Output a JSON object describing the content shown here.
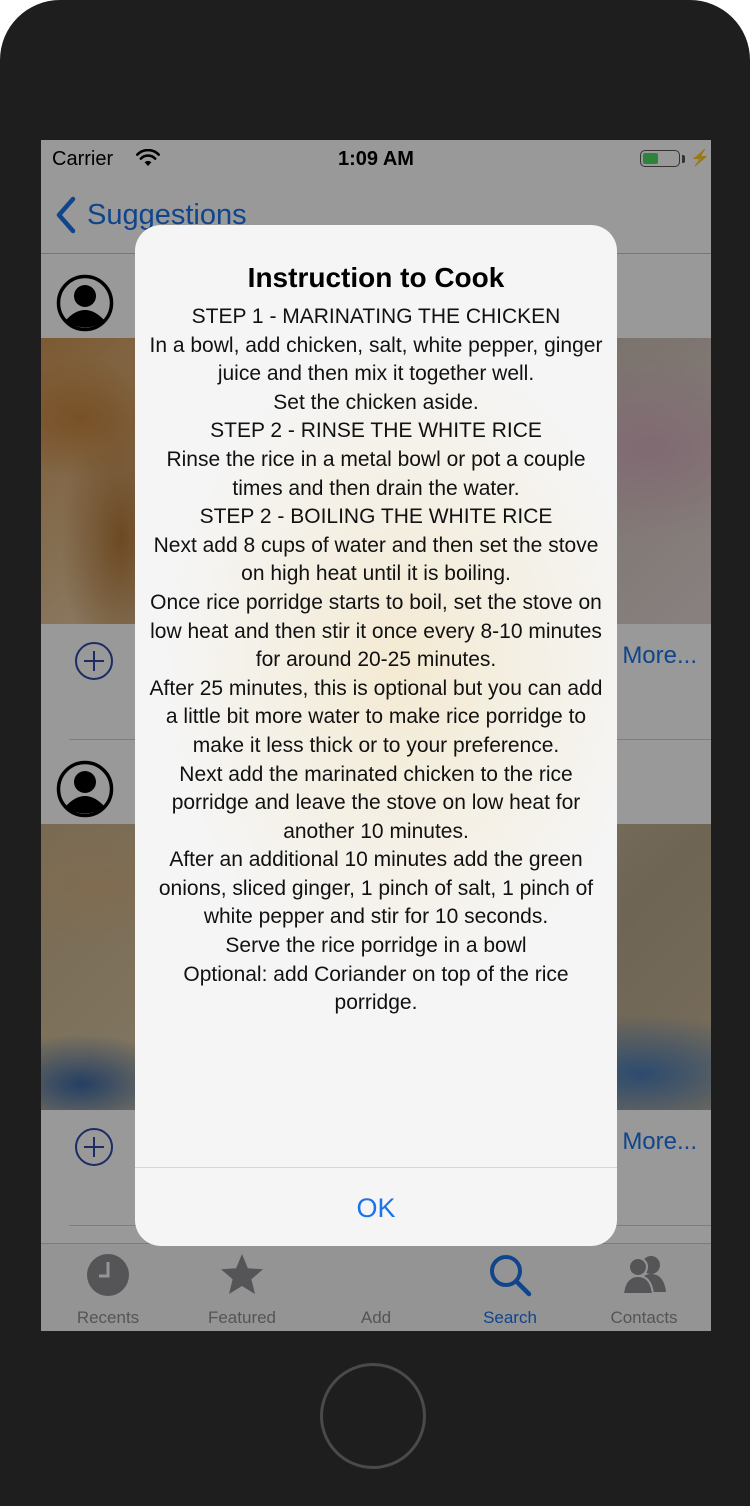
{
  "status_bar": {
    "carrier": "Carrier",
    "time": "1:09 AM",
    "battery_level": 0.45,
    "wifi_icon": "wifi-icon",
    "charging_icon": "⚡"
  },
  "nav": {
    "back_label": "Suggestions",
    "back_icon": "chevron-left-icon"
  },
  "cards": [
    {
      "more_label": "More...",
      "photo": "chicken-dish"
    },
    {
      "more_label": "More...",
      "photo": "rice-porridge"
    }
  ],
  "tabs": [
    {
      "label": "Recents",
      "icon": "clock-icon"
    },
    {
      "label": "Featured",
      "icon": "star-icon"
    },
    {
      "label": "Add",
      "icon": ""
    },
    {
      "label": "Search",
      "icon": "search-icon",
      "active": true
    },
    {
      "label": "Contacts",
      "icon": "contacts-icon"
    }
  ],
  "alert": {
    "title": "Instruction to Cook",
    "message": "STEP 1 - MARINATING THE CHICKEN\nIn a bowl, add chicken, salt, white pepper, ginger juice and then mix it together well.\nSet the chicken aside.\nSTEP 2 - RINSE THE WHITE RICE\nRinse the rice in a metal bowl or pot a couple times and then drain the water.\nSTEP 2 - BOILING THE WHITE RICE\nNext add 8 cups of water and then set the stove on high heat until it is boiling.\nOnce rice porridge starts to boil, set the stove on low heat and then stir it once every 8-10 minutes for around 20-25 minutes.\nAfter 25 minutes, this is optional but you can add a little bit more water to make rice porridge to make it less thick or to your preference.\nNext add the marinated chicken to the rice porridge and leave the stove on low heat for another 10 minutes.\nAfter an additional 10 minutes add the green onions, sliced ginger, 1 pinch of salt, 1 pinch of white pepper and stir for 10 seconds.\nServe the rice porridge in a bowl\nOptional: add Coriander on top of the rice porridge.",
    "ok_label": "OK"
  },
  "colors": {
    "accent": "#1b74e8",
    "dim_overlay": "rgba(0,0,0,0.40)",
    "alert_bg": "#f5f5f5",
    "tab_inactive": "#8e8e93",
    "device_frame": "#1e1e1e"
  }
}
